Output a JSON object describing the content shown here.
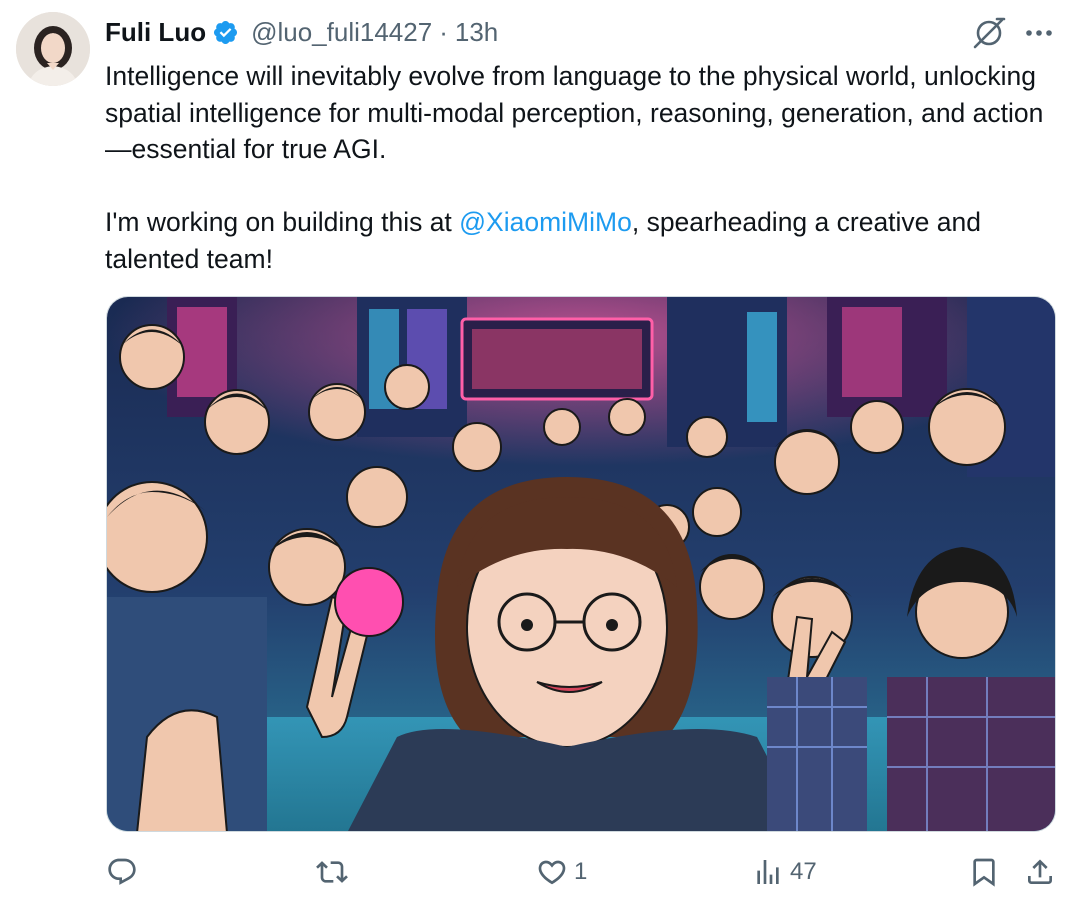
{
  "author": {
    "name": "Fuli Luo",
    "handle": "@luo_fuli14427",
    "separator": "·",
    "time": "13h",
    "verified_color": "#1d9bf0"
  },
  "post": {
    "paragraph_1": "Intelligence will inevitably evolve from language to the physical world, unlocking spatial intelligence for multi-modal perception, reasoning, generation, and action—essential for true AGI.",
    "paragraph_2_before": "I'm working on building this at ",
    "mention": "@XiaomiMiMo",
    "paragraph_2_after": ", spearheading a creative and talented team!"
  },
  "media": {
    "description_icon": "cyberpunk-group-selfie-illustration"
  },
  "actions": {
    "reply_icon": "reply-icon",
    "repost_icon": "repost-icon",
    "like_icon": "heart-icon",
    "like_count": "1",
    "views_icon": "analytics-icon",
    "views_count": "47",
    "bookmark_icon": "bookmark-icon",
    "share_icon": "share-icon"
  },
  "colors": {
    "text": "#0f1419",
    "secondary": "#536471",
    "link": "#1d9bf0"
  }
}
